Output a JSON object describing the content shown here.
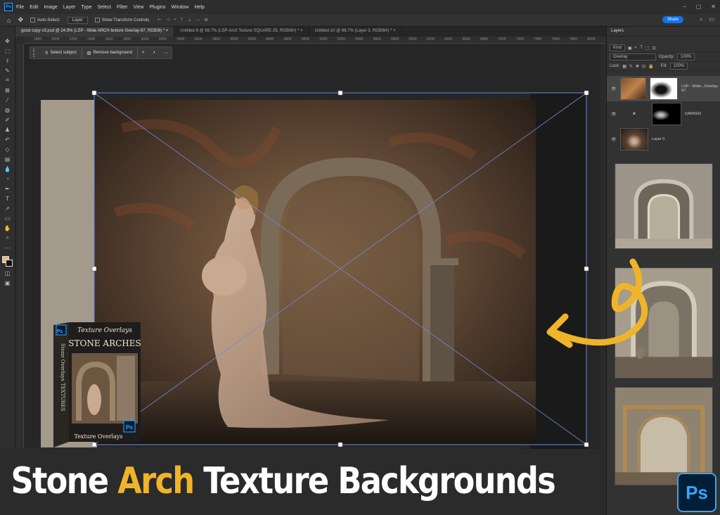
{
  "menubar": {
    "items": [
      "File",
      "Edit",
      "Image",
      "Layer",
      "Type",
      "Select",
      "Filter",
      "View",
      "Plugins",
      "Window",
      "Help"
    ]
  },
  "options": {
    "auto_select": "Auto-Select:",
    "layer_select": "Layer",
    "show_transform": "Show Transform Controls",
    "share": "Share"
  },
  "tabs": [
    {
      "label": "good copy v3.psd @ 24.9% (LSP - Wide ARCH texture Overlay-97, RGB/8) *",
      "active": true
    },
    {
      "label": "Untitled-9 @ 69.7% (LSP-Arch Texture SQUARE-29, RGB/8#) *",
      "active": false
    },
    {
      "label": "Untitled-10 @ 66.7% (Layer 3, RGB/8#) *",
      "active": false
    }
  ],
  "ruler": [
    "1800",
    "2000",
    "2200",
    "2400",
    "2600",
    "2800",
    "3000",
    "3200",
    "3400",
    "3600",
    "3800",
    "4000",
    "4200",
    "4400",
    "4600",
    "4800",
    "5000",
    "5200",
    "5400",
    "5600",
    "5800",
    "6000",
    "6200",
    "6400",
    "6600",
    "6800",
    "7000",
    "7200",
    "7400",
    "7600",
    "7800",
    "8000"
  ],
  "context_bar": {
    "select_subject": "Select subject",
    "remove_background": "Remove background"
  },
  "layers_panel": {
    "title": "Layers",
    "filter": "Kind",
    "blend_mode": "Overlay",
    "opacity_label": "Opacity:",
    "opacity": "100%",
    "lock_label": "Lock:",
    "fill_label": "Fill:",
    "fill": "100%",
    "layers": [
      {
        "name": "LSP - Wide...Overlay-97"
      },
      {
        "name": "DARKEN"
      },
      {
        "name": "Layer 0"
      }
    ]
  },
  "product_box": {
    "title_script": "Texture Overlays",
    "title_main": "STONE ARCHES",
    "side_text": "Stone Overlays TEXTURES",
    "footer": "Texture Overlays",
    "ps": "Ps"
  },
  "banner": {
    "part1": "Stone ",
    "accent": "Arch",
    "part2": " Texture Backgrounds"
  },
  "ps_badge": "Ps",
  "colors": {
    "accent": "#f0b429",
    "photoshop_blue": "#31a8ff",
    "share_blue": "#1473e6"
  }
}
